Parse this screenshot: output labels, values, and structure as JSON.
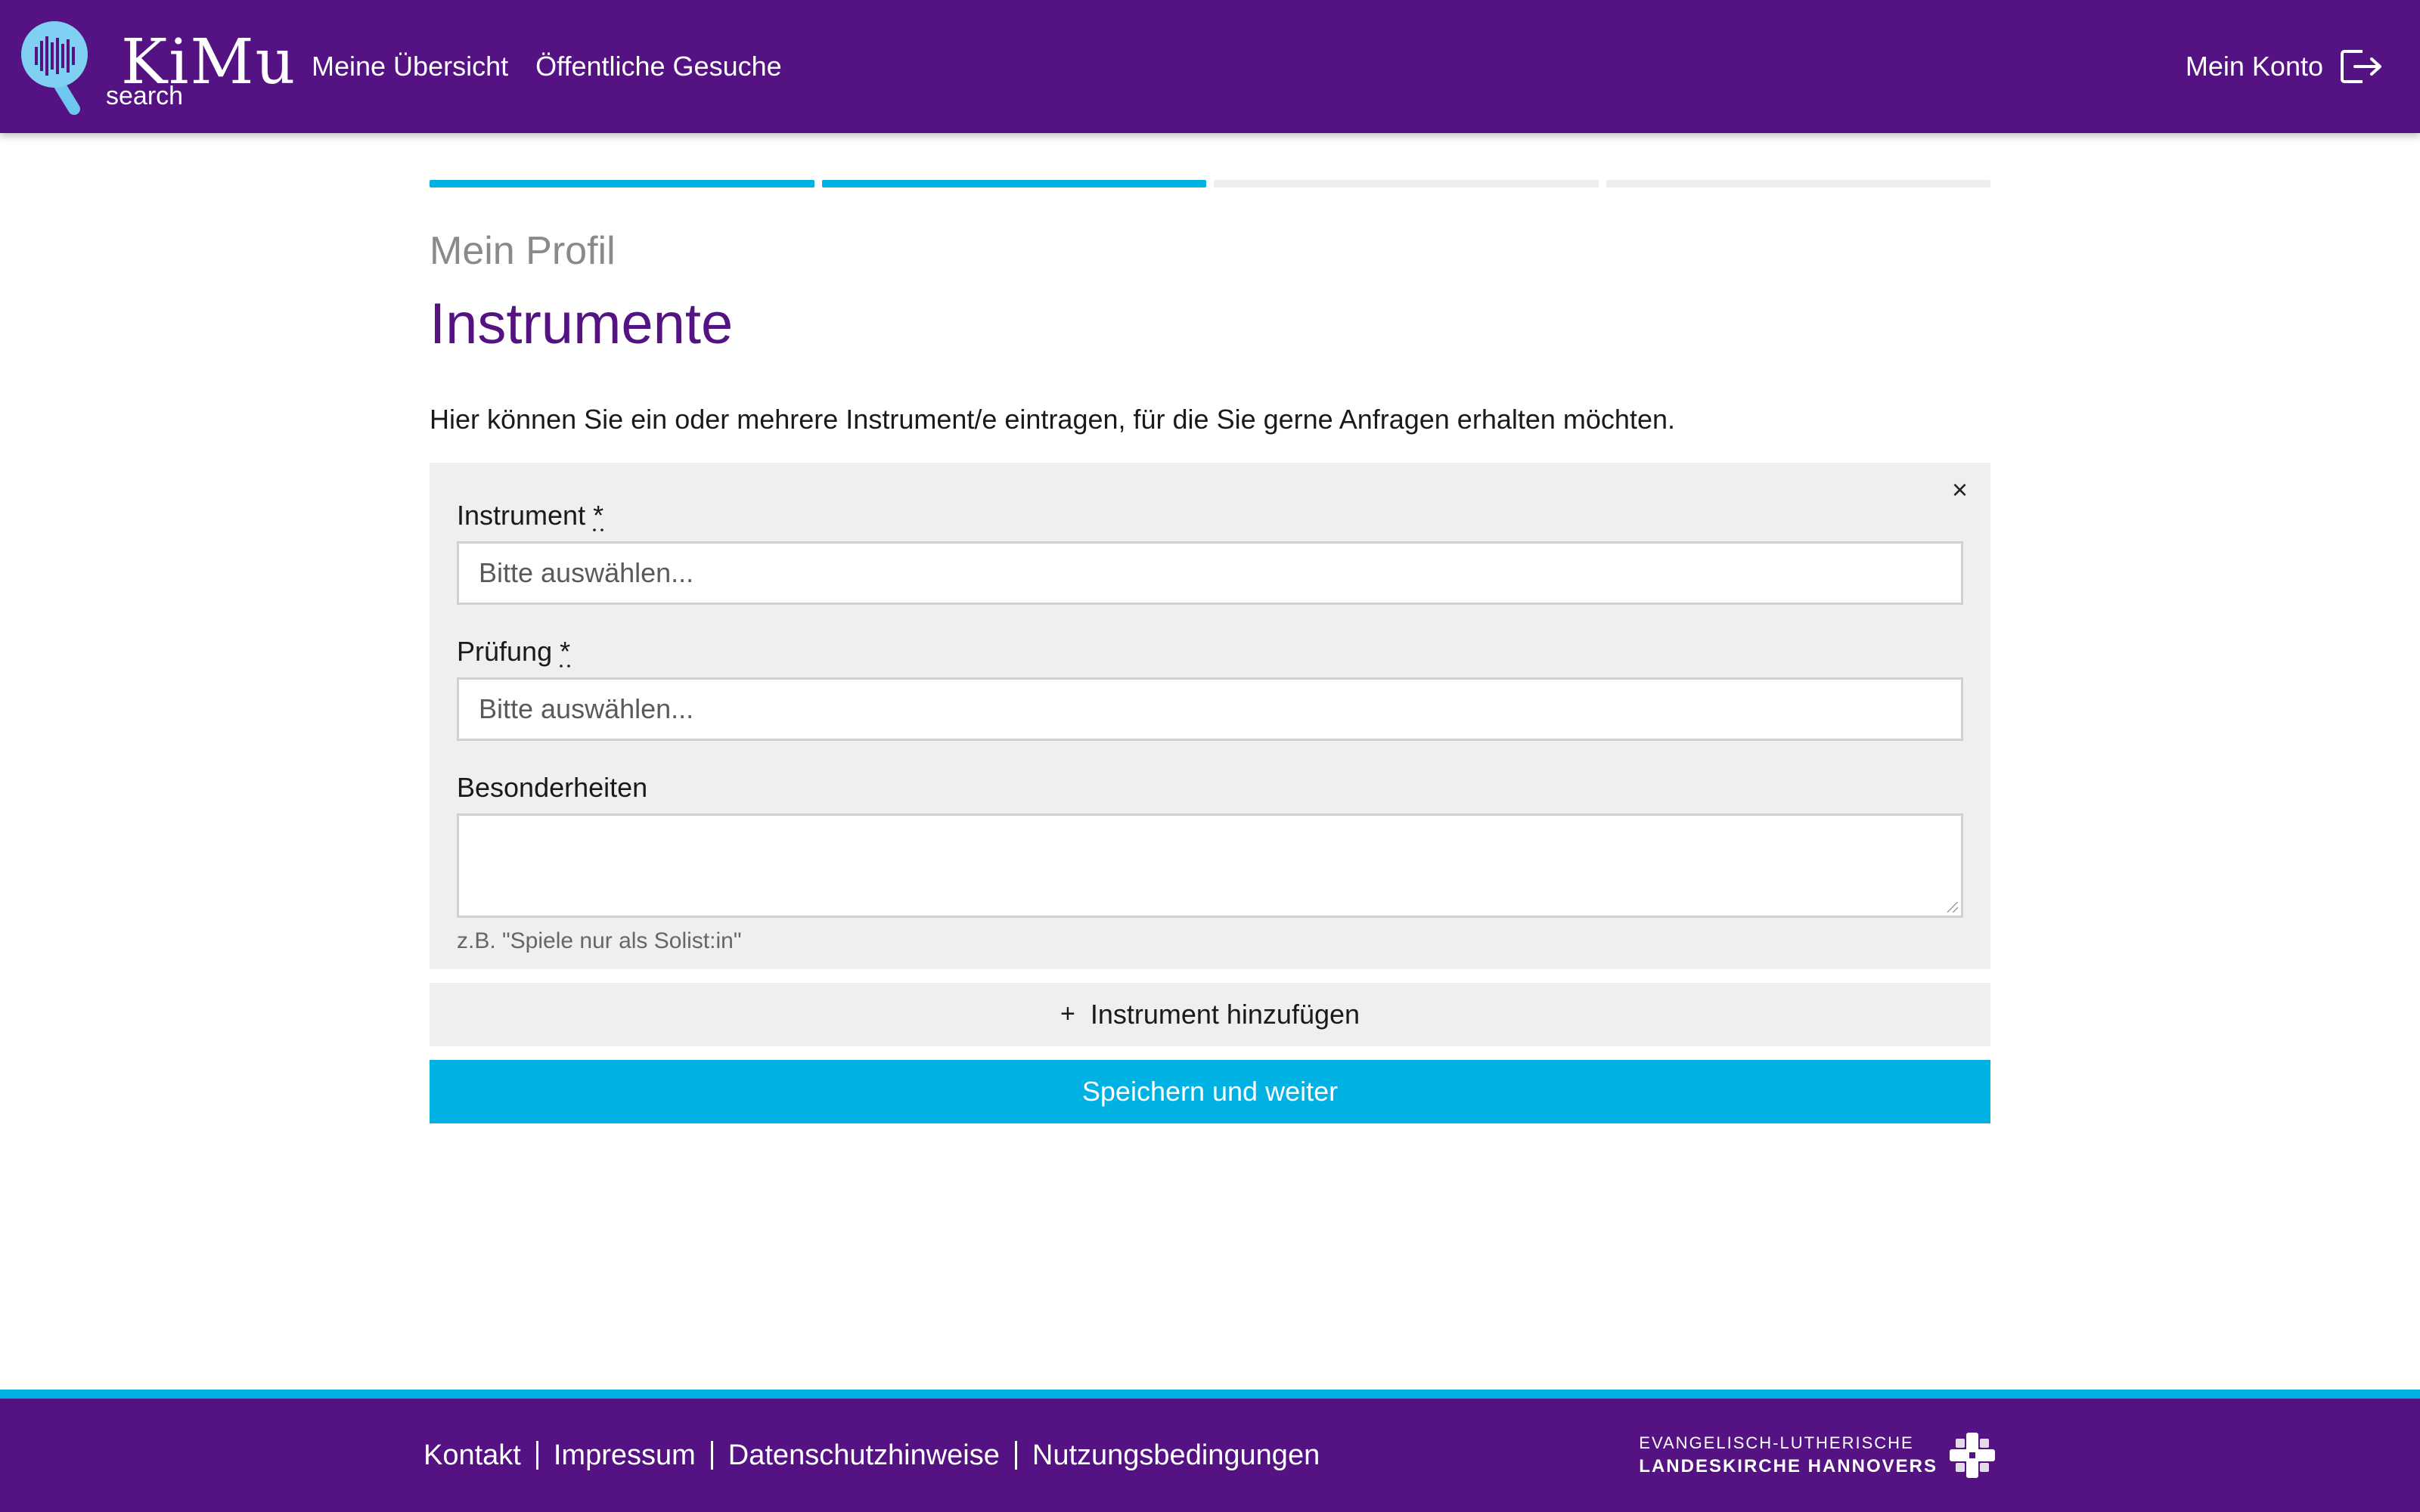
{
  "brand": {
    "name": "KiMu",
    "subtitle": "search",
    "logo_icon": "magnifier-soundwave-icon"
  },
  "colors": {
    "primary": "#541283",
    "accent": "#00b2e4",
    "panel": "#efefef"
  },
  "nav": {
    "items": [
      {
        "label": "Meine Übersicht"
      },
      {
        "label": "Öffentliche Gesuche"
      }
    ],
    "account_label": "Mein Konto",
    "account_icon": "logout-icon"
  },
  "progress": {
    "steps_total": 4,
    "steps_done": 2
  },
  "page": {
    "eyebrow": "Mein Profil",
    "title": "Instrumente",
    "intro": "Hier können Sie ein oder mehrere Instrument/e eintragen, für die Sie gerne Anfragen erhalten möchten."
  },
  "form": {
    "close_label": "×",
    "instrument": {
      "label": "Instrument",
      "required_mark": "*",
      "placeholder": "Bitte auswählen..."
    },
    "exam": {
      "label": "Prüfung",
      "required_mark": "*",
      "placeholder": "Bitte auswählen..."
    },
    "notes": {
      "label": "Besonderheiten",
      "value": "",
      "hint": "z.B. \"Spiele nur als Solist:in\""
    },
    "add_label": "Instrument hinzufügen",
    "add_icon": "plus-icon",
    "save_label": "Speichern und weiter"
  },
  "footer": {
    "links": [
      {
        "label": "Kontakt"
      },
      {
        "label": "Impressum"
      },
      {
        "label": "Datenschutzhinweise"
      },
      {
        "label": "Nutzungsbedingungen"
      }
    ],
    "church_line1": "EVANGELISCH-LUTHERISCHE",
    "church_line2": "LANDESKIRCHE HANNOVERS",
    "church_icon": "cross-logo-icon"
  }
}
